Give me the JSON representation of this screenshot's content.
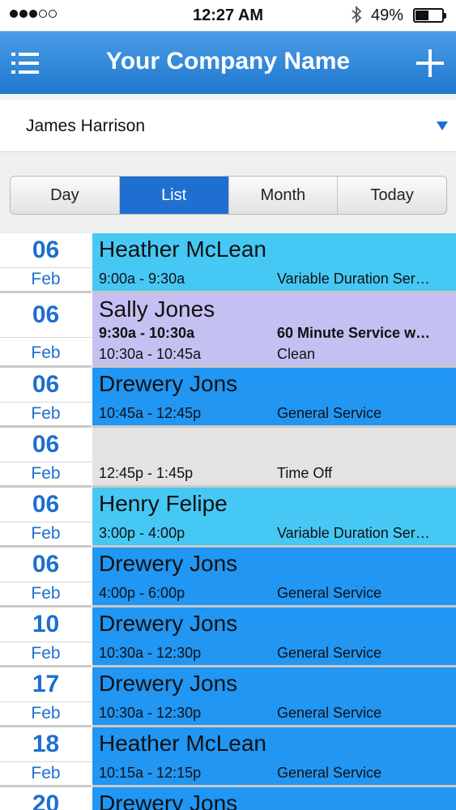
{
  "status_bar": {
    "time": "12:27 AM",
    "battery": "49%",
    "battery_level": 0.49
  },
  "header": {
    "title": "Your Company Name",
    "menu_icon": "menu-list-icon",
    "add_icon": "plus-icon"
  },
  "staff": {
    "name": "James Harrison"
  },
  "tabs": [
    {
      "label": "Day",
      "active": false
    },
    {
      "label": "List",
      "active": true
    },
    {
      "label": "Month",
      "active": false
    },
    {
      "label": "Today",
      "active": false
    }
  ],
  "colors": {
    "accent": "#1f6fd0",
    "light_blue": "#46c8f5",
    "blue": "#2196f3",
    "purple": "#c5c0f2",
    "gray": "#e3e3e3"
  },
  "appointments": [
    {
      "day": "06",
      "month": "Feb",
      "client": "Heather McLean",
      "lines": [
        {
          "time": "9:00a - 9:30a",
          "service": "Variable Duration Ser…"
        }
      ],
      "color": "#46c8f5"
    },
    {
      "day": "06",
      "month": "Feb",
      "client": "Sally Jones",
      "lines": [
        {
          "time": "9:30a - 10:30a",
          "service": "60 Minute Service w…",
          "bold": true
        },
        {
          "time": "10:30a - 10:45a",
          "service": "Clean"
        }
      ],
      "color": "#c5c0f2"
    },
    {
      "day": "06",
      "month": "Feb",
      "client": "Drewery Jons",
      "lines": [
        {
          "time": "10:45a - 12:45p",
          "service": "General Service"
        }
      ],
      "color": "#2196f3"
    },
    {
      "day": "06",
      "month": "Feb",
      "client": "",
      "lines": [
        {
          "time": "12:45p - 1:45p",
          "service": "Time Off"
        }
      ],
      "color": "#e3e3e3"
    },
    {
      "day": "06",
      "month": "Feb",
      "client": "Henry Felipe",
      "lines": [
        {
          "time": "3:00p - 4:00p",
          "service": "Variable Duration Ser…"
        }
      ],
      "color": "#46c8f5"
    },
    {
      "day": "06",
      "month": "Feb",
      "client": "Drewery Jons",
      "lines": [
        {
          "time": "4:00p - 6:00p",
          "service": "General Service"
        }
      ],
      "color": "#2196f3"
    },
    {
      "day": "10",
      "month": "Feb",
      "client": "Drewery Jons",
      "lines": [
        {
          "time": "10:30a - 12:30p",
          "service": "General Service"
        }
      ],
      "color": "#2196f3"
    },
    {
      "day": "17",
      "month": "Feb",
      "client": "Drewery Jons",
      "lines": [
        {
          "time": "10:30a - 12:30p",
          "service": "General Service"
        }
      ],
      "color": "#2196f3"
    },
    {
      "day": "18",
      "month": "Feb",
      "client": "Heather McLean",
      "lines": [
        {
          "time": "10:15a - 12:15p",
          "service": "General Service"
        }
      ],
      "color": "#2196f3"
    },
    {
      "day": "20",
      "month": "Feb",
      "client": "Drewery Jons",
      "lines": [
        {
          "time": "",
          "service": ""
        }
      ],
      "color": "#2196f3"
    }
  ]
}
